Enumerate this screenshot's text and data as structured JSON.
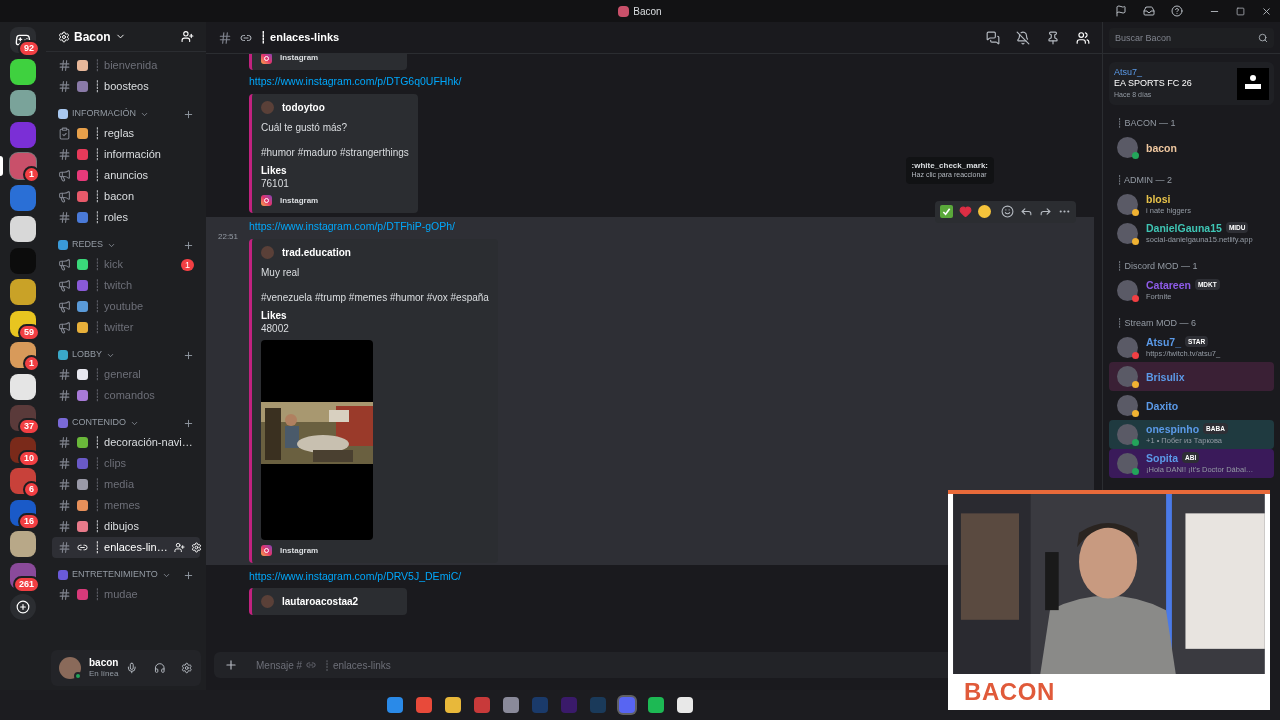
{
  "title_bar": {
    "title": "Bacon"
  },
  "servers": [
    {
      "kind": "home",
      "badge": "92",
      "color": "#2b2d31",
      "selected": false
    },
    {
      "kind": "icon",
      "color": "#3fd13f",
      "selected": false
    },
    {
      "kind": "icon",
      "color": "#7aa39a",
      "selected": false
    },
    {
      "kind": "icon",
      "color": "#7b2fd6",
      "selected": false
    },
    {
      "kind": "icon",
      "color": "#c9506a",
      "badge": "1",
      "selected": true
    },
    {
      "kind": "icon",
      "color": "#2a6fd6",
      "selected": false
    },
    {
      "kind": "icon",
      "color": "#d8d8d8",
      "selected": false
    },
    {
      "kind": "icon",
      "color": "#0c0c0c",
      "selected": false
    },
    {
      "kind": "icon",
      "color": "#c9a227",
      "selected": false
    },
    {
      "kind": "icon",
      "color": "#e8c520",
      "badge": "59",
      "selected": false
    },
    {
      "kind": "icon",
      "color": "#d89a5a",
      "badge": "1",
      "selected": false
    },
    {
      "kind": "icon",
      "color": "#e5e5e5",
      "selected": false
    },
    {
      "kind": "icon",
      "color": "#5a3a3a",
      "badge": "37",
      "selected": false
    },
    {
      "kind": "icon",
      "color": "#7a2a1a",
      "badge": "10",
      "selected": false
    },
    {
      "kind": "icon",
      "color": "#c8413a",
      "badge": "6",
      "selected": false
    },
    {
      "kind": "icon",
      "color": "#1a5ac8",
      "badge": "16",
      "selected": false
    },
    {
      "kind": "icon",
      "color": "#b8a888",
      "selected": false
    },
    {
      "kind": "icon",
      "color": "#8a4a9a",
      "badge": "261",
      "selected": false
    },
    {
      "kind": "add",
      "color": "#2b2d31"
    }
  ],
  "server_header": {
    "name": "Bacon"
  },
  "channels": [
    {
      "kind": "text",
      "name": "┊ bienvenida",
      "color": "#e8b89a",
      "unread": false,
      "selected": false
    },
    {
      "kind": "text",
      "name": "┊ boosteos",
      "color": "#8a7aa8",
      "unread": true,
      "selected": false
    }
  ],
  "categories": [
    {
      "name": "INFORMACIÓN",
      "color": "#a8c8f0",
      "channels": [
        {
          "kind": "rules",
          "name": "┊ reglas",
          "color": "#e8a04a",
          "unread": true,
          "selected": false
        },
        {
          "kind": "text",
          "name": "┊ información",
          "color": "#e83a5a",
          "unread": true,
          "selected": false
        },
        {
          "kind": "announce",
          "name": "┊ anuncios",
          "color": "#e83a7a",
          "unread": true,
          "selected": false
        },
        {
          "kind": "announce",
          "name": "┊ bacon",
          "color": "#e85a6a",
          "unread": true,
          "selected": false
        },
        {
          "kind": "text",
          "name": "┊ roles",
          "color": "#4a7ad8",
          "unread": true,
          "selected": false
        }
      ]
    },
    {
      "name": "REDES",
      "color": "#3a9ad8",
      "channels": [
        {
          "kind": "announce",
          "name": "┊ kick",
          "color": "#3ad87a",
          "unread": false,
          "selected": false,
          "badge": "1"
        },
        {
          "kind": "announce",
          "name": "┊ twitch",
          "color": "#8a5ad8",
          "unread": false,
          "selected": false
        },
        {
          "kind": "announce",
          "name": "┊ youtube",
          "color": "#5a9ad8",
          "unread": false,
          "selected": false
        },
        {
          "kind": "announce",
          "name": "┊ twitter",
          "color": "#e8b03a",
          "unread": false,
          "selected": false
        }
      ]
    },
    {
      "name": "LOBBY",
      "color": "#3aa8c8",
      "channels": [
        {
          "kind": "text",
          "name": "┊ general",
          "color": "#e8e8f0",
          "unread": false,
          "selected": false
        },
        {
          "kind": "text",
          "name": "┊ comandos",
          "color": "#a87ad8",
          "unread": false,
          "selected": false
        }
      ]
    },
    {
      "name": "CONTENIDO",
      "color": "#7a6ad8",
      "channels": [
        {
          "kind": "text",
          "name": "┊ decoración-navi…",
          "color": "#6ab83a",
          "unread": true,
          "selected": false
        },
        {
          "kind": "text",
          "name": "┊ clips",
          "color": "#6a5ac8",
          "unread": false,
          "selected": false
        },
        {
          "kind": "text",
          "name": "┊ media",
          "color": "#9a9aa8",
          "unread": false,
          "selected": false
        },
        {
          "kind": "text",
          "name": "┊ memes",
          "color": "#e8905a",
          "unread": false,
          "selected": false
        },
        {
          "kind": "text",
          "name": "┊ dibujos",
          "color": "#e87a8a",
          "unread": true,
          "selected": false
        },
        {
          "kind": "text",
          "name": "┊ enlaces-lin…",
          "unread": true,
          "selected": true
        }
      ]
    },
    {
      "name": "ENTRETENIMIENTO",
      "color": "#6a5ad8",
      "channels": [
        {
          "kind": "text",
          "name": "┊ mudae",
          "color": "#d83a7a",
          "unread": false,
          "selected": false
        }
      ]
    }
  ],
  "user_panel": {
    "name": "bacon",
    "status_text": "En línea",
    "kind": "online"
  },
  "channel_header": {
    "name": "┊ enlaces-links"
  },
  "search": {
    "placeholder": "Buscar Bacon"
  },
  "messages": [
    {
      "kind": "partial",
      "hovered": false,
      "embed": {
        "footer": "Instagram"
      }
    },
    {
      "kind": "link",
      "hovered": false,
      "link": "https://www.instagram.com/p/DTG6q0UFHhk/",
      "embed": {
        "author": "todoytoo",
        "description": "Cuál te gustó más?",
        "tags": "#humor #maduro #strangerthings",
        "field_name": "Likes",
        "field_value": "76101",
        "footer": "Instagram"
      }
    },
    {
      "kind": "link",
      "hovered": true,
      "time": "22:51",
      "link": "https://www.instagram.com/p/DTFhiP-gOPh/",
      "embed": {
        "author": "trad.education",
        "description": "Muy real",
        "tags": "#venezuela #trump #memes #humor #vox #españa",
        "field_name": "Likes",
        "field_value": "48002",
        "video": true,
        "footer": "Instagram"
      }
    },
    {
      "kind": "link",
      "hovered": false,
      "link": "https://www.instagram.com/p/DRV5J_DEmiC/",
      "embed": {
        "author": "lautaroacostaa2"
      }
    }
  ],
  "reaction_tooltip": {
    "title": ":white_check_mark:",
    "hint": "Haz clic para reaccionar"
  },
  "composer": {
    "placeholder": "Mensaje #",
    "channel": "┊ enlaces-links"
  },
  "activity_card": {
    "user": "Atsu7_",
    "game": "EA SPORTS FC 26",
    "time": "Hace 8 días"
  },
  "member_groups": [
    {
      "title": "┊ BACON — 1",
      "members": [
        {
          "name": "bacon",
          "color": "#f0c8a0",
          "kind": "online"
        }
      ]
    },
    {
      "title": "┊ ADMIN — 2",
      "members": [
        {
          "name": "blosi",
          "color": "#e8c34a",
          "kind": "idle",
          "sub": "i nate higgers"
        },
        {
          "name": "DanielGauna15",
          "color": "#3fc6b5",
          "kind": "idle",
          "tag": "MIDU",
          "sub": "social-danielgauna15.netlify.app"
        }
      ]
    },
    {
      "title": "┊ Discord MOD — 1",
      "members": [
        {
          "name": "Catareen",
          "color": "#8e5be8",
          "kind": "dnd",
          "tag": "MDKT",
          "sub": "Fortnite"
        }
      ]
    },
    {
      "title": "┊ Stream MOD — 6",
      "members": [
        {
          "name": "Atsu7_",
          "color": "#5b9ae8",
          "kind": "dnd",
          "tag": "STAR",
          "sub": "https://twitch.tv/atsu7_"
        },
        {
          "name": "Brisulix",
          "color": "#5b9ae8",
          "kind": "idle",
          "banner": {
            "color": "#3a2035"
          }
        },
        {
          "name": "Daxito",
          "color": "#5b9ae8",
          "kind": "idle"
        },
        {
          "name": "onespinho",
          "color": "#5b9ae8",
          "kind": "online",
          "tag": "BABA",
          "sub": "+1 • Побег из Таркова",
          "banner": {
            "color": "#1f3a40"
          }
        },
        {
          "name": "Sopita",
          "color": "#5b9ae8",
          "kind": "online",
          "tag": "ABI",
          "sub": "¡Hola DANI! ¡It's Doctor Dábal…",
          "banner": {
            "color": "#3a1a5a"
          }
        }
      ]
    }
  ],
  "overlay": {
    "label": "BACON"
  },
  "taskbar": [
    {
      "color": "#2a8ae8",
      "active": false
    },
    {
      "color": "#e84a3a",
      "active": false
    },
    {
      "color": "#e8b83a",
      "active": false
    },
    {
      "color": "#c83a3a",
      "active": false
    },
    {
      "color": "#8a8a9a",
      "active": false
    },
    {
      "color": "#1a3a6a",
      "active": false
    },
    {
      "color": "#3a1a6a",
      "active": false
    },
    {
      "color": "#1a3a5a",
      "active": false
    },
    {
      "color": "#5865f2",
      "active": true
    },
    {
      "color": "#1db954",
      "active": false
    },
    {
      "color": "#e8e8e8",
      "active": false
    }
  ]
}
